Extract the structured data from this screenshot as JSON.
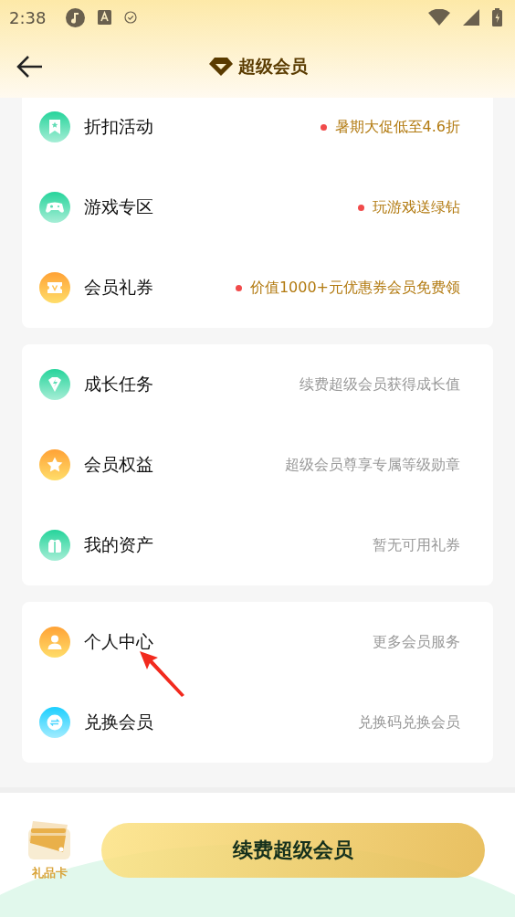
{
  "status_bar": {
    "time": "2:38"
  },
  "header": {
    "title": "超级会员"
  },
  "sections": [
    {
      "items": [
        {
          "label": "折扣活动",
          "hint": "暑期大促低至4.6折",
          "highlighted": true
        },
        {
          "label": "游戏专区",
          "hint": "玩游戏送绿钻",
          "highlighted": true
        },
        {
          "label": "会员礼券",
          "hint": "价值1000+元优惠券会员免费领",
          "highlighted": true
        }
      ]
    },
    {
      "items": [
        {
          "label": "成长任务",
          "hint": "续费超级会员获得成长值",
          "highlighted": false
        },
        {
          "label": "会员权益",
          "hint": "超级会员尊享专属等级勋章",
          "highlighted": false
        },
        {
          "label": "我的资产",
          "hint": "暂无可用礼券",
          "highlighted": false
        }
      ]
    },
    {
      "items": [
        {
          "label": "个人中心",
          "hint": "更多会员服务",
          "highlighted": false
        },
        {
          "label": "兑换会员",
          "hint": "兑换码兑换会员",
          "highlighted": false
        }
      ]
    }
  ],
  "bottom_bar": {
    "gift_card": "礼品卡",
    "renew_button": "续费超级会员"
  }
}
